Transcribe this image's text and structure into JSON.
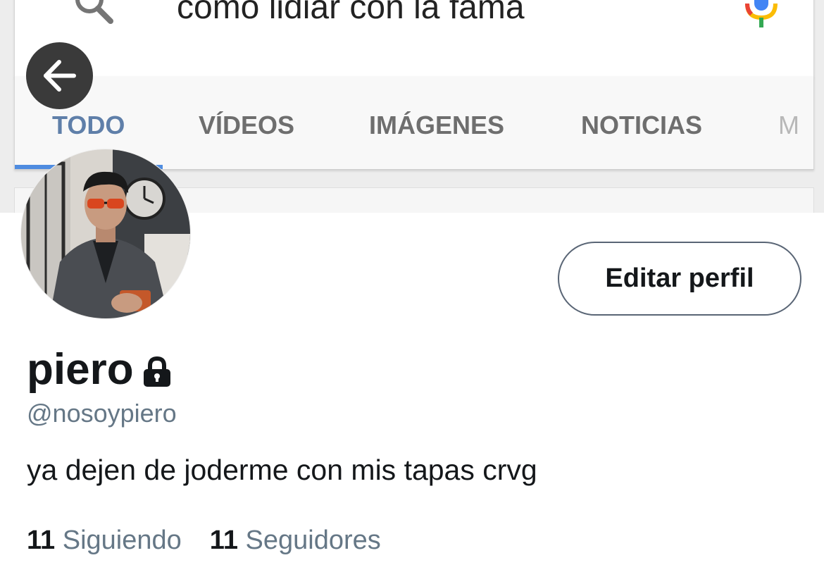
{
  "search": {
    "query": "como lidiar con la fama",
    "tabs": [
      {
        "label": "TODO",
        "active": true
      },
      {
        "label": "VÍDEOS",
        "active": false
      },
      {
        "label": "IMÁGENES",
        "active": false
      },
      {
        "label": "NOTICIAS",
        "active": false
      },
      {
        "label": "M",
        "active": false
      }
    ]
  },
  "profile": {
    "display_name": "piero",
    "locked": true,
    "handle": "@nosoypiero",
    "bio": "ya dejen de joderme con mis tapas crvg",
    "edit_button_label": "Editar perfil",
    "following_count": "11",
    "following_label": "Siguiendo",
    "followers_count": "11",
    "followers_label": "Seguidores"
  },
  "icons": {
    "back": "arrow-left-icon",
    "search": "search-icon",
    "mic": "microphone-icon",
    "lock": "lock-icon"
  },
  "colors": {
    "tab_active": "#5f7fa9",
    "tab_indicator": "#4f8ce0",
    "secondary_text": "#657786",
    "button_border": "#596575"
  }
}
